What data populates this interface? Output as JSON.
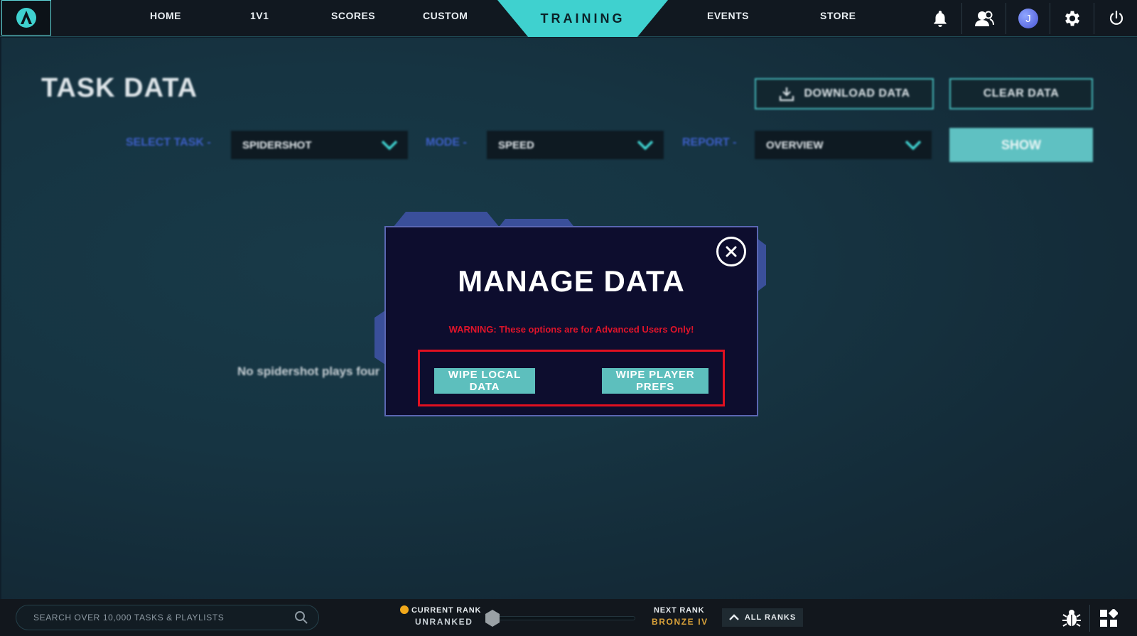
{
  "nav": {
    "items": [
      "HOME",
      "1V1",
      "SCORES",
      "CUSTOM",
      "TRAINING",
      "EVENTS",
      "STORE"
    ],
    "active": "TRAINING",
    "avatar_initial": "J",
    "icons": [
      "bell-icon",
      "friends-icon",
      "avatar",
      "gear-icon",
      "power-icon"
    ]
  },
  "page": {
    "title": "TASK DATA",
    "download_button": "DOWNLOAD DATA",
    "clear_button": "CLEAR DATA",
    "filters": {
      "task_label": "SELECT TASK -",
      "task_value": "SPIDERSHOT",
      "mode_label": "MODE -",
      "mode_value": "SPEED",
      "report_label": "REPORT -",
      "report_value": "OVERVIEW"
    },
    "show_button": "SHOW",
    "empty_message": "No spidershot plays four"
  },
  "modal": {
    "title": "MANAGE DATA",
    "warning": "WARNING: These options are for Advanced Users Only!",
    "wipe_local_line1": "WIPE LOCAL",
    "wipe_local_line2": "DATA",
    "wipe_prefs_line1": "WIPE PLAYER",
    "wipe_prefs_line2": "PREFS"
  },
  "bottom": {
    "search_placeholder": "SEARCH OVER 10,000 TASKS & PLAYLISTS",
    "current_rank_label": "CURRENT RANK",
    "current_rank_value": "UNRANKED",
    "next_rank_label": "NEXT RANK",
    "next_rank_value": "BRONZE IV",
    "all_ranks_label": "ALL RANKS",
    "rank_progress": 0
  },
  "colors": {
    "accent": "#3fd1cf",
    "warning": "#e0142a",
    "highlight_border": "#e01020",
    "next_rank": "#d9a23a",
    "modal_bg": "#0d0d2e"
  }
}
